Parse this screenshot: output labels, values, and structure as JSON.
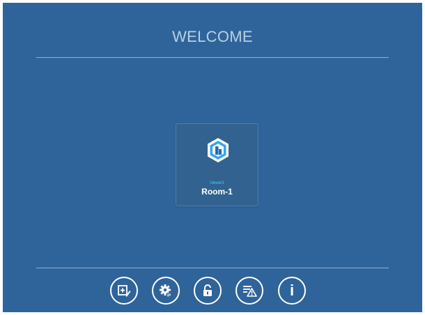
{
  "header": {
    "title": "WELCOME"
  },
  "rooms": [
    {
      "viewer": "Viewer1",
      "name": "Room-1",
      "icon": "building-hexagon-icon"
    }
  ],
  "toolbar": {
    "buttons": [
      {
        "icon": "add-edit-icon"
      },
      {
        "icon": "settings-ip-icon"
      },
      {
        "icon": "unlock-icon"
      },
      {
        "icon": "alarm-list-icon"
      },
      {
        "icon": "info-icon",
        "glyph": "i"
      }
    ]
  },
  "colors": {
    "background": "#2f649b",
    "title_text": "#b9cfe6",
    "accent_cyan": "#34d2ff",
    "divider": "#8eb0d2"
  }
}
